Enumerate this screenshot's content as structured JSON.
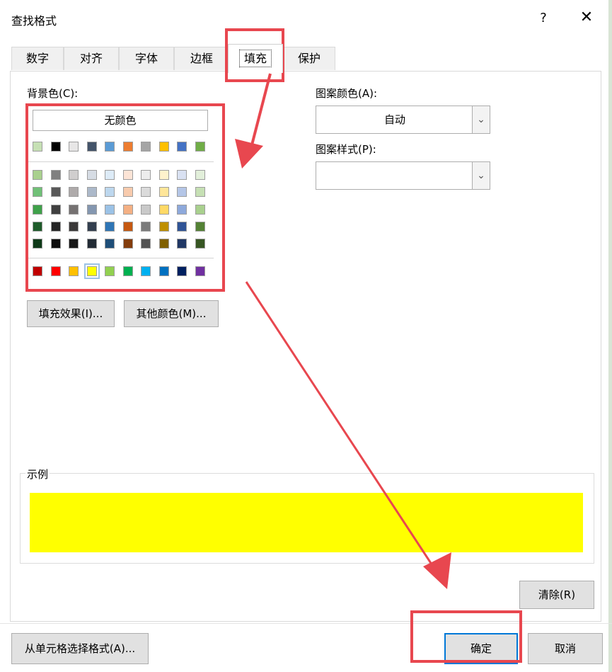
{
  "dialog": {
    "title": "查找格式",
    "help_label": "?",
    "close_label": "✕"
  },
  "tabs": [
    {
      "label": "数字"
    },
    {
      "label": "对齐"
    },
    {
      "label": "字体"
    },
    {
      "label": "边框"
    },
    {
      "label": "填充",
      "active": true
    },
    {
      "label": "保护"
    }
  ],
  "fill": {
    "background_label": "背景色(C):",
    "no_color_label": "无颜色",
    "pattern_color_label": "图案颜色(A):",
    "pattern_color_value": "自动",
    "pattern_style_label": "图案样式(P):",
    "pattern_style_value": "",
    "fill_effects_label": "填充效果(I)...",
    "more_colors_label": "其他颜色(M)...",
    "selected_color": "#FFFF00",
    "palette_row1": [
      "#C6E0B4",
      "#000000",
      "#E7E6E6",
      "#44546A",
      "#5B9BD5",
      "#ED7D31",
      "#A5A5A5",
      "#FFC000",
      "#4472C4",
      "#70AD47"
    ],
    "palette_theme": [
      [
        "#A9D08E",
        "#808080",
        "#D0CECE",
        "#D6DCE4",
        "#DDEBF7",
        "#FCE4D6",
        "#EDEDED",
        "#FFF2CC",
        "#D9E1F2",
        "#E2EFDA"
      ],
      [
        "#70C077",
        "#595959",
        "#AEAAAA",
        "#ACB9CA",
        "#BDD7EE",
        "#F8CBAD",
        "#DBDBDB",
        "#FFE699",
        "#B4C6E7",
        "#C6E0B4"
      ],
      [
        "#3FA14A",
        "#404040",
        "#757171",
        "#8497B0",
        "#9BC2E6",
        "#F4B084",
        "#C9C9C9",
        "#FFD966",
        "#8EA9DB",
        "#A9D08E"
      ],
      [
        "#1E5B2A",
        "#262626",
        "#3A3838",
        "#333F4F",
        "#2F75B5",
        "#C65911",
        "#7B7B7B",
        "#BF8F00",
        "#305496",
        "#548235"
      ],
      [
        "#0F3A18",
        "#0D0D0D",
        "#161616",
        "#222B35",
        "#1F4E78",
        "#833C0C",
        "#525252",
        "#806000",
        "#203764",
        "#375623"
      ]
    ],
    "palette_standard": [
      "#C00000",
      "#FF0000",
      "#FFC000",
      "#FFFF00",
      "#92D050",
      "#00B050",
      "#00B0F0",
      "#0070C0",
      "#002060",
      "#7030A0"
    ]
  },
  "sample": {
    "label": "示例",
    "color": "#FFFF00"
  },
  "buttons": {
    "clear_label": "清除(R)",
    "from_cell_label": "从单元格选择格式(A)...",
    "ok_label": "确定",
    "cancel_label": "取消"
  },
  "annotation_color": "#E8474F"
}
